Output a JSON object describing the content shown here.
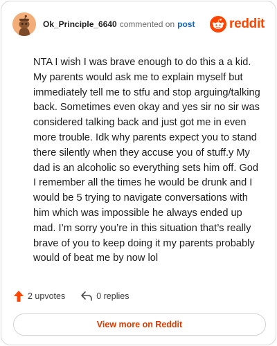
{
  "header": {
    "username": "Ok_Principle_6640",
    "commented_on": "commented on",
    "post_link": "post",
    "brand": "reddit"
  },
  "comment": {
    "text": "NTA I wish I was brave enough to do this a a kid. My parents would ask me to explain myself but immediately tell me to stfu and stop arguing/talking back. Sometimes even okay and yes sir no sir was considered talking back and just got me in even more trouble. Idk why parents expect you to stand there silently when they accuse you of stuff.y My dad is an alcoholic so everything sets him off. God I remember all the times he would be drunk and I would be 5 trying to navigate conversations with him which was impossible he always ended up mad. I’m sorry you’re in this situation that’s really brave of you to keep doing it my parents probably would of beat me by now lol"
  },
  "actions": {
    "upvotes": "2 upvotes",
    "replies": "0 replies"
  },
  "footer": {
    "view_more": "View more on Reddit"
  },
  "icons": {
    "avatar": "snoo-avatar",
    "brand_logo": "reddit-logo-icon",
    "upvote": "upvote-arrow-icon",
    "reply": "reply-arrow-icon"
  },
  "colors": {
    "brand": "#ff4500",
    "upvote": "#ff4500",
    "link": "#0a66c2",
    "view_more": "#d93a00"
  }
}
